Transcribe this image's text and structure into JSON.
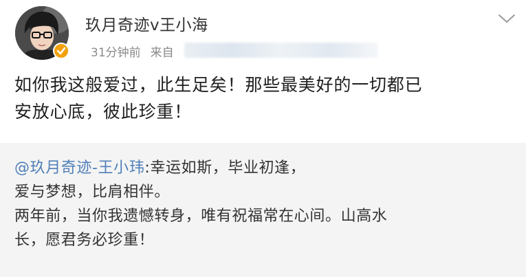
{
  "post": {
    "username": "玖月奇迹v王小海",
    "time": "31分钟前",
    "source_prefix": "来自",
    "content_line1": "如你我这般爱过，此生足矣！那些最美好的一切都已",
    "content_line2": "安放心底，彼此珍重！"
  },
  "repost": {
    "mention": "@玖月奇迹-王小玮",
    "line1_rest": ":幸运如斯，毕业初逢，",
    "line2": "爱与梦想，比肩相伴。",
    "line3": "两年前，当你我遗憾转身，唯有祝福常在心间。山高水",
    "line4": "长，愿君务必珍重！"
  },
  "colors": {
    "mention": "#4f7fb8",
    "verified_badge": "#f2a10c",
    "repost_background": "#f4f4f4"
  },
  "icons": {
    "avatar": "avatar",
    "verified": "verified-badge-icon",
    "menu": "chevron-down-icon"
  }
}
